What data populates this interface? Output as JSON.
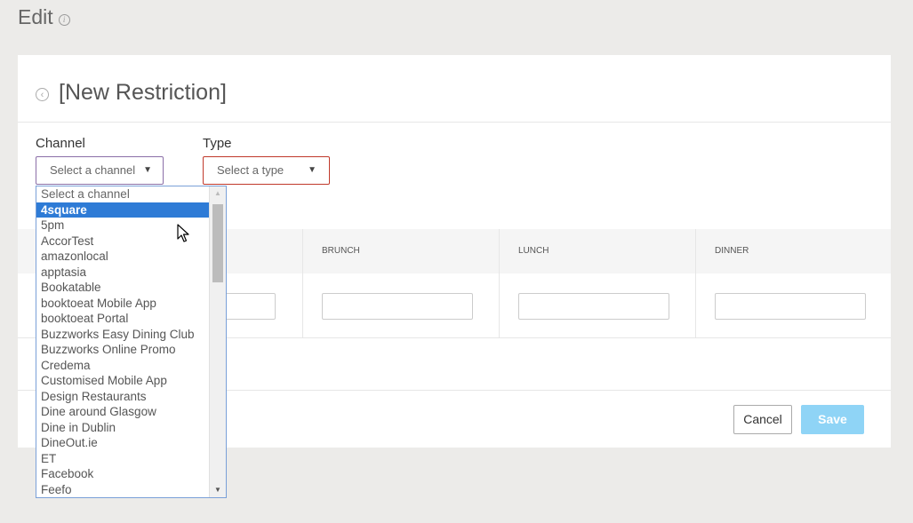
{
  "page": {
    "title": "Edit",
    "info_glyph": "i"
  },
  "card": {
    "title": "[New Restriction]",
    "back_glyph": "‹"
  },
  "channel": {
    "label": "Channel",
    "value": "Select a channel",
    "arrow": "▼"
  },
  "type": {
    "label": "Type",
    "value": "Select a type",
    "arrow": "▼"
  },
  "grid": {
    "columns": [
      "",
      "BRUNCH",
      "LUNCH",
      "DINNER"
    ]
  },
  "buttons": {
    "cancel": "Cancel",
    "save": "Save"
  },
  "dropdown": {
    "selected": "4square",
    "options": [
      "Select a channel",
      "4square",
      "5pm",
      "AccorTest",
      "amazonlocal",
      "apptasia",
      "Bookatable",
      "booktoeat Mobile App",
      "booktoeat Portal",
      "Buzzworks Easy Dining Club",
      "Buzzworks Online Promo",
      "Credema",
      "Customised Mobile App",
      "Design Restaurants",
      "Dine around Glasgow",
      "Dine in Dublin",
      "DineOut.ie",
      "ET",
      "Facebook",
      "Feefo"
    ],
    "scroll_up": "▲",
    "scroll_down": "▼"
  },
  "colors": {
    "background": "#ecebe9",
    "selected_option": "#2e7bd6",
    "save_button": "#8fd4f6",
    "type_border": "#c0392b"
  },
  "icons": [
    "info-icon",
    "back-circle-icon",
    "dropdown-arrow-icon",
    "mouse-cursor-icon"
  ]
}
